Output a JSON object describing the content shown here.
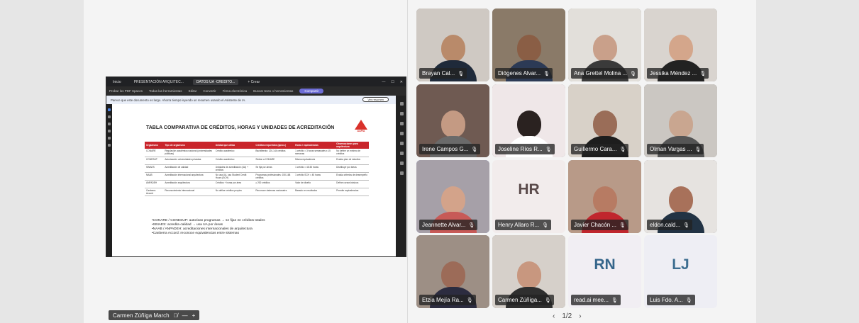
{
  "shared_screen": {
    "browser_tabs": [
      "Inicio",
      "PRESENTACIÓN ARQUITEC...",
      "DATOS UA -CREDITO...",
      "+ Crear"
    ],
    "toolbar_items": [
      "Probar los PDF Spaces",
      "Todas las herramientas",
      "Editar",
      "Convertir",
      "Firma electrónica",
      "Buscar texto o herramientas",
      "Compartir"
    ],
    "banner_text": "Parece que este documento es largo. Ahorra tiempo leyendo un resumen usando el Asistente de IA.",
    "banner_button": "Ver resumen",
    "document": {
      "title": "TABLA COMPARATIVA DE CRÉDITOS, HORAS Y UNIDADES DE ACREDITACIÓN",
      "logo_text": "AAPIA",
      "table_headers": [
        "Organismo",
        "Tipo de organismo",
        "Unidad que utiliza",
        "Créditos requeridos (aprox.)",
        "Horas / equivalencias",
        "Observaciones para arquitectura"
      ],
      "table_rows": [
        [
          "CONARE",
          "Regulación académica nacional (universidades públicas)",
          "Crédito académico",
          "Bachillerato: 120-144 créditos",
          "1 crédito = 3 horas semanales x 15 semanas",
          "No define un mínimo de créditos"
        ],
        [
          "CONESUP",
          "Autorización universidades privadas",
          "Crédito académico",
          "Similar a CONARE",
          "Misma equivalencia",
          "Evalúa plan de estudios"
        ],
        [
          "SINAES",
          "Acreditación de calidad",
          "Unidades de acreditación (UA) + créditos",
          "Se fija por áreas",
          "1 crédito = 45-50 horas",
          "Distribuye por áreas"
        ],
        [
          "NAAB",
          "Acreditación internacional arquitectura",
          "No usa UA, usa Student Credit Hours (SCH)",
          "Programas profesionales: 150-168 créditos",
          "1 crédito SCH = 45 horas",
          "Evalúa criterios de desempeño"
        ],
        [
          "ANPADEH",
          "Acreditación arquitectura",
          "Créditos + horas por área",
          "≥ 200 créditos",
          "Valor de diseño",
          "Define cursos básicos"
        ],
        [
          "Canberra Accord",
          "Reconocimiento internacional",
          "No define créditos propios",
          "Reconoce sistemas nacionales",
          "Basado en resultados",
          "Permite equivalencias"
        ]
      ],
      "notes": [
        "•CONARE / CONESUP: autorizan programas → se fijan en créditos totales",
        "•SINAES: acredita calidad → usa UA por áreas",
        "•NAAB / ANPADEH: acreditaciones internacionales de arquitectura",
        "•Canberra Accord: reconoce equivalencias entre sistemas"
      ]
    }
  },
  "presenter_label": "Carmen Zúñiga March",
  "participants": [
    {
      "name": "Brayan Cal...",
      "type": "video"
    },
    {
      "name": "Diógenes Alvar...",
      "type": "video"
    },
    {
      "name": "Ana Grettel Molina ...",
      "type": "video"
    },
    {
      "name": "Jessika Méndez ...",
      "type": "video"
    },
    {
      "name": "Irene Campos G...",
      "type": "video"
    },
    {
      "name": "Joseline Ríos R...",
      "type": "video"
    },
    {
      "name": "Guillermo Cara...",
      "type": "video"
    },
    {
      "name": "Olman Vargas ...",
      "type": "video"
    },
    {
      "name": "Jeannette Alvar...",
      "type": "video"
    },
    {
      "name": "Henry Allaro R...",
      "type": "avatar",
      "initials": "HR",
      "color": "#5a4a4a"
    },
    {
      "name": "Javier Chacón ...",
      "type": "video"
    },
    {
      "name": "eldon.cald...",
      "type": "video"
    },
    {
      "name": "Etzia Mejía Ra...",
      "type": "video"
    },
    {
      "name": "Carmen Zúñiga...",
      "type": "video"
    },
    {
      "name": "read.ai mee...",
      "type": "avatar",
      "initials": "RN",
      "color": "#35658a"
    },
    {
      "name": "Luis Fdo. A...",
      "type": "avatar",
      "initials": "LJ",
      "color": "#3d6e90"
    }
  ],
  "pager": {
    "prev": "‹",
    "label": "1/2",
    "next": "›"
  }
}
